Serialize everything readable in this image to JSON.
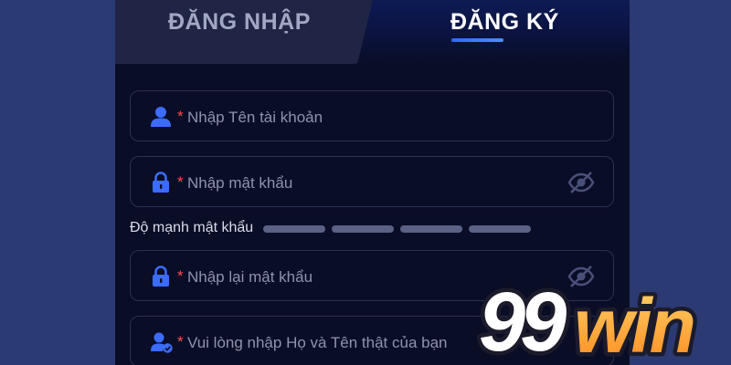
{
  "tabs": {
    "login_label": "ĐĂNG NHẬP",
    "register_label": "ĐĂNG KÝ",
    "active": "register"
  },
  "form": {
    "required_mark": "*",
    "username": {
      "placeholder": "Nhập Tên tài khoản",
      "value": "",
      "icon": "user-icon"
    },
    "password": {
      "placeholder": "Nhập mật khẩu",
      "value": "",
      "icon": "lock-icon",
      "toggle_icon": "eye-slash-icon"
    },
    "strength": {
      "label": "Độ mạnh mật khẩu",
      "segments": 4,
      "filled": 0
    },
    "confirm_password": {
      "placeholder": "Nhập lại mật khẩu",
      "value": "",
      "icon": "lock-icon",
      "toggle_icon": "eye-slash-icon"
    },
    "fullname": {
      "placeholder": "Vui lòng nhập Họ và Tên thật của bạn",
      "value": "",
      "icon": "user-check-icon"
    }
  },
  "logo": {
    "text": "99win"
  },
  "colors": {
    "accent": "#3b6cff",
    "required": "#ff4d4f",
    "background": "#0a0d26",
    "outer": "#2c3a73"
  }
}
